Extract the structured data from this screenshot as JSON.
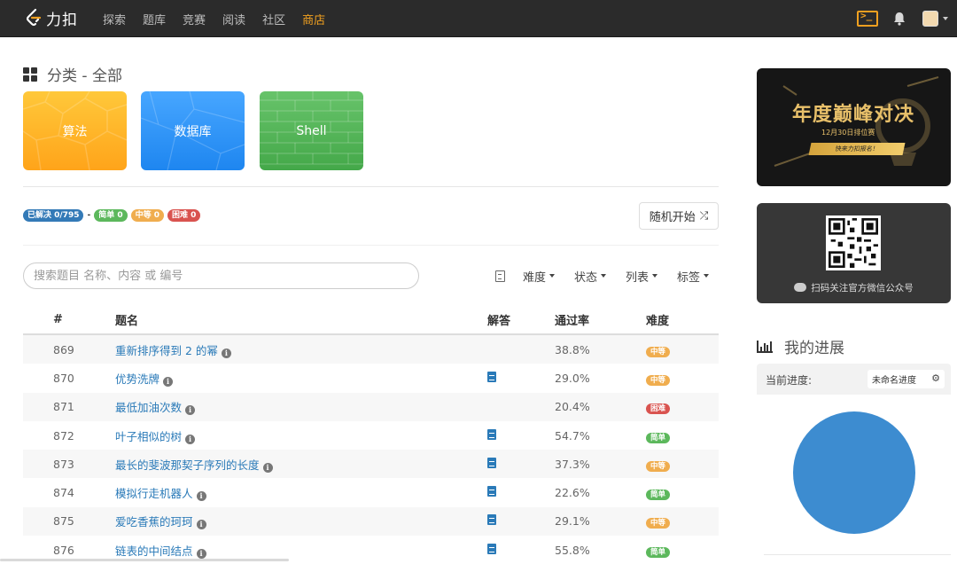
{
  "brand": {
    "name": "力扣"
  },
  "nav": [
    {
      "label": "探索",
      "active": false
    },
    {
      "label": "题库",
      "active": false
    },
    {
      "label": "竞赛",
      "active": false
    },
    {
      "label": "阅读",
      "active": false
    },
    {
      "label": "社区",
      "active": false
    },
    {
      "label": "商店",
      "active": true
    }
  ],
  "section": {
    "title": "分类 - 全部"
  },
  "categories": [
    {
      "label": "算法",
      "color": "#ffb12a"
    },
    {
      "label": "数据库",
      "color": "#2d8ff5"
    },
    {
      "label": "Shell",
      "color": "#52b256"
    }
  ],
  "stats": {
    "solved": "已解决 0/795",
    "separator": "-",
    "easy": "简单 0",
    "medium": "中等 0",
    "hard": "困难 0"
  },
  "random_button": {
    "label": "随机开始",
    "icon": "shuffle-icon"
  },
  "search": {
    "placeholder": "搜索题目 名称、内容 或 编号",
    "value": ""
  },
  "filters": {
    "difficulty": "难度",
    "status": "状态",
    "list": "列表",
    "tags": "标签"
  },
  "table": {
    "headers": {
      "num": "#",
      "title": "题名",
      "solution": "解答",
      "rate": "通过率",
      "difficulty": "难度"
    },
    "rows": [
      {
        "num": "869",
        "title": "重新排序得到 2 的幂",
        "has_solution": false,
        "rate": "38.8%",
        "difficulty": "中等",
        "diff_color": "#f0ad4e"
      },
      {
        "num": "870",
        "title": "优势洗牌",
        "has_solution": true,
        "rate": "29.0%",
        "difficulty": "中等",
        "diff_color": "#f0ad4e"
      },
      {
        "num": "871",
        "title": "最低加油次数",
        "has_solution": false,
        "rate": "20.4%",
        "difficulty": "困难",
        "diff_color": "#d9534f"
      },
      {
        "num": "872",
        "title": "叶子相似的树",
        "has_solution": true,
        "rate": "54.7%",
        "difficulty": "简单",
        "diff_color": "#5cb85c"
      },
      {
        "num": "873",
        "title": "最长的斐波那契子序列的长度",
        "has_solution": true,
        "rate": "37.3%",
        "difficulty": "中等",
        "diff_color": "#f0ad4e"
      },
      {
        "num": "874",
        "title": "模拟行走机器人",
        "has_solution": true,
        "rate": "22.6%",
        "difficulty": "简单",
        "diff_color": "#5cb85c"
      },
      {
        "num": "875",
        "title": "爱吃香蕉的珂珂",
        "has_solution": true,
        "rate": "29.1%",
        "difficulty": "中等",
        "diff_color": "#f0ad4e"
      },
      {
        "num": "876",
        "title": "链表的中间结点",
        "has_solution": true,
        "rate": "55.8%",
        "difficulty": "简单",
        "diff_color": "#5cb85c"
      }
    ]
  },
  "banner": {
    "title": "年度巅峰对决",
    "subtitle": "12月30日排位赛",
    "cta": "快来力扣报名！"
  },
  "qr_card": {
    "caption": "扫码关注官方微信公众号"
  },
  "progress": {
    "title": "我的进展",
    "label": "当前进度:",
    "selected": "未命名进度"
  }
}
